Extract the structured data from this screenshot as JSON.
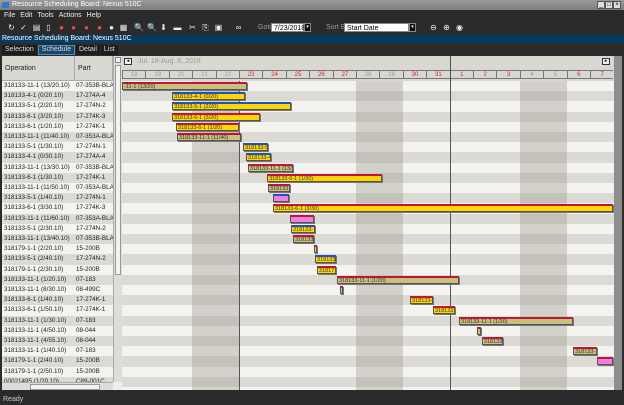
{
  "window": {
    "title": "Resource Scheduling Board: Nexus 510C",
    "controls": [
      "_",
      "□",
      "×"
    ]
  },
  "menu": [
    "File",
    "Edit",
    "Tools",
    "Actions",
    "Help"
  ],
  "toolbar": {
    "goto_label": "Goto",
    "goto_value": "7/23/2018",
    "sort_label": "Sort By",
    "sort_value": "Start Date"
  },
  "subtitle": "Resource Scheduling Board: Nexus 510C",
  "tabs": [
    "Selection",
    "Schedule",
    "Detail",
    "List"
  ],
  "active_tab": "Schedule",
  "columns": {
    "operation": "Operation",
    "part": "Part"
  },
  "rows": [
    [
      "318133-11-1 (13/20.10)",
      "07-353B-BLAI"
    ],
    [
      "318133-4-1 (0/20.10)",
      "17-274A-4"
    ],
    [
      "318133-5-1 (2/20.10)",
      "17-274N-2"
    ],
    [
      "318133-6-1 (3/20.10)",
      "17-274K-3"
    ],
    [
      "318133-6-1 (1/20.10)",
      "17-274K-1"
    ],
    [
      "318133-11-1 (11/40.10)",
      "07-353A-BLAI"
    ],
    [
      "318133-5-1 (1/30.10)",
      "17-274N-1"
    ],
    [
      "318133-4-1 (0/30.10)",
      "17-274A-4"
    ],
    [
      "318133-11-1 (13/30.10)",
      "07-353B-BLAI"
    ],
    [
      "318133-6-1 (1/30.10)",
      "17-274K-1"
    ],
    [
      "318133-11-1 (11/50.10)",
      "07-353A-BLAI"
    ],
    [
      "318133-5-1 (1/40.10)",
      "17-274N-1"
    ],
    [
      "318133-6-1 (3/30.10)",
      "17-274K-3"
    ],
    [
      "318133-11-1 (11/60.10)",
      "07-353A-BLAI"
    ],
    [
      "318133-5-1 (2/30.10)",
      "17-274N-2"
    ],
    [
      "318133-11-1 (13/40.10)",
      "07-353B-BLAI"
    ],
    [
      "318179-1-1 (2/20.10)",
      "15-200B"
    ],
    [
      "318133-5-1 (2/40.10)",
      "17-274N-2"
    ],
    [
      "318179-1-1 (2/30.10)",
      "15-200B"
    ],
    [
      "318133-11-1 (1/20.10)",
      "07-183"
    ],
    [
      "318133-11-1 (8/30.10)",
      "08-499C"
    ],
    [
      "318133-6-1 (1/40.10)",
      "17-274K-1"
    ],
    [
      "318133-6-1 (1/50.10)",
      "17-274K-1"
    ],
    [
      "318133-11-1 (1/30.10)",
      "07-183"
    ],
    [
      "318133-11-1 (4/50.10)",
      "08-044"
    ],
    [
      "318133-11-1 (4/55.10)",
      "08-044"
    ],
    [
      "318133-11-1 (1/40.10)",
      "07-183"
    ],
    [
      "318179-1-1 (2/40.10)",
      "15-200B"
    ],
    [
      "318179-1-1 (2/50.10)",
      "15-200B"
    ],
    [
      "00021495 (1/20.10)",
      "C89-001C"
    ]
  ],
  "timeline": {
    "range": "Jul. 18-Aug. 8, 2018",
    "days": [
      "18",
      "19",
      "20",
      "21",
      "22",
      "23",
      "24",
      "25",
      "26",
      "27",
      "28",
      "29",
      "30",
      "31",
      "1",
      "2",
      "3",
      "4",
      "5",
      "6",
      "7"
    ],
    "weekend": [
      3,
      4,
      10,
      11,
      17,
      18
    ],
    "today_index": 5,
    "month_break_index": 14
  },
  "colors": {
    "olive": "#c9c17a",
    "yellow": "#ffd700",
    "pink": "#f080e0",
    "red": "#c0143c",
    "blue": "#2050c8"
  },
  "bars": [
    {
      "row": 0,
      "start": 0,
      "end": 5.35,
      "fill": "olive",
      "top": "red",
      "label": "-11-1 (13/20)"
    },
    {
      "row": 1,
      "start": 2.14,
      "end": 5.26,
      "fill": "yellow",
      "top": "blue",
      "label": "318133-4-1 (0/20)"
    },
    {
      "row": 2,
      "start": 2.14,
      "end": 7.22,
      "fill": "yellow",
      "top": "blue",
      "label": "318133-5-1 (2/20)"
    },
    {
      "row": 3,
      "start": 2.14,
      "end": 5.9,
      "fill": "yellow",
      "top": "red",
      "label": "318133-6-1 (3/20)"
    },
    {
      "row": 4,
      "start": 2.31,
      "end": 5.0,
      "fill": "yellow",
      "top": "red",
      "label": "318133-6-1 (1/20)"
    },
    {
      "row": 5,
      "start": 2.35,
      "end": 5.09,
      "fill": "olive",
      "top": "red",
      "label": "318133-11-1 (11/40)"
    },
    {
      "row": 6,
      "start": 5.17,
      "end": 6.24,
      "fill": "yellow",
      "top": "blue",
      "label": "318133-5"
    },
    {
      "row": 7,
      "start": 5.3,
      "end": 6.37,
      "fill": "yellow",
      "top": "blue",
      "label": "318133-4"
    },
    {
      "row": 8,
      "start": 5.38,
      "end": 7.31,
      "fill": "olive",
      "top": "red",
      "label": "318133-11-1 (13/"
    },
    {
      "row": 9,
      "start": 6.2,
      "end": 11.11,
      "fill": "yellow",
      "top": "red",
      "label": "318133-6-1 (1/30)"
    },
    {
      "row": 10,
      "start": 6.24,
      "end": 7.18,
      "fill": "olive",
      "top": "red",
      "label": "318133"
    },
    {
      "row": 11,
      "start": 6.45,
      "end": 7.14,
      "fill": "pink",
      "top": "blue",
      "label": ""
    },
    {
      "row": 12,
      "start": 6.45,
      "end": 21,
      "fill": "yellow",
      "top": "red",
      "label": "318133-6-1 (3/30)"
    },
    {
      "row": 13,
      "start": 7.18,
      "end": 8.2,
      "fill": "pink",
      "top": "red",
      "label": ""
    },
    {
      "row": 14,
      "start": 7.22,
      "end": 8.25,
      "fill": "yellow",
      "top": "blue",
      "label": "318133-"
    },
    {
      "row": 15,
      "start": 7.31,
      "end": 8.2,
      "fill": "olive",
      "top": "red",
      "label": "318133"
    },
    {
      "row": 16,
      "start": 8.2,
      "end": 8.33,
      "fill": "yellow",
      "top": "red",
      "label": ""
    },
    {
      "row": 17,
      "start": 8.25,
      "end": 9.15,
      "fill": "yellow",
      "top": "blue",
      "label": "318133"
    },
    {
      "row": 18,
      "start": 8.33,
      "end": 9.15,
      "fill": "yellow",
      "top": "red",
      "label": "318177"
    },
    {
      "row": 19,
      "start": 9.19,
      "end": 14.4,
      "fill": "olive",
      "top": "red",
      "label": "318133-11-1 (1/20)"
    },
    {
      "row": 20,
      "start": 9.32,
      "end": 9.45,
      "fill": "olive",
      "top": "red",
      "label": ""
    },
    {
      "row": 21,
      "start": 12.31,
      "end": 13.29,
      "fill": "yellow",
      "top": "red",
      "label": "318133-"
    },
    {
      "row": 22,
      "start": 13.29,
      "end": 14.23,
      "fill": "yellow",
      "top": "red",
      "label": "318133"
    },
    {
      "row": 23,
      "start": 14.4,
      "end": 19.28,
      "fill": "olive",
      "top": "red",
      "label": "318133-11-1 (1/30)"
    },
    {
      "row": 24,
      "start": 15.17,
      "end": 15.34,
      "fill": "olive",
      "top": "red",
      "label": ""
    },
    {
      "row": 25,
      "start": 15.38,
      "end": 16.28,
      "fill": "olive",
      "top": "red",
      "label": "318133"
    },
    {
      "row": 26,
      "start": 19.28,
      "end": 20.3,
      "fill": "olive",
      "top": "red",
      "label": "318133-"
    },
    {
      "row": 27,
      "start": 20.3,
      "end": 21,
      "fill": "pink",
      "top": "red",
      "label": ""
    }
  ],
  "status": "Ready"
}
